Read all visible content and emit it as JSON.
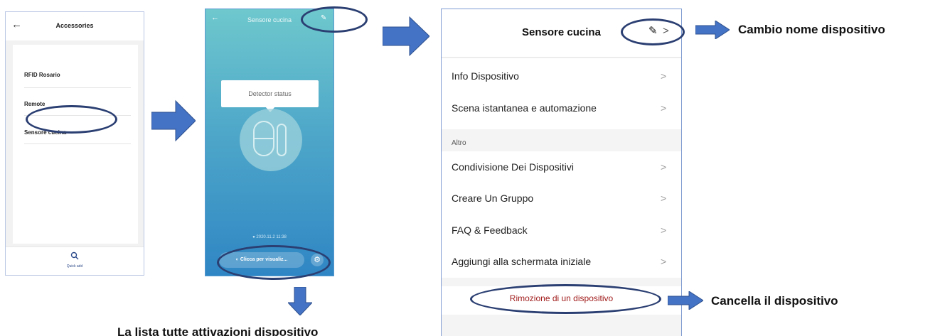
{
  "panel1": {
    "title": "Accessories",
    "items": [
      "RFID Rosario",
      "Remote",
      "Sensore cucina"
    ],
    "quick_add_label": "Quick add"
  },
  "panel2": {
    "title": "Sensore cucina",
    "tooltip": "Detector status",
    "timestamp": "2020.11.2 11:38",
    "view_button_label": "Clicca per visualiz..."
  },
  "panel3": {
    "title": "Sensore cucina",
    "group1": [
      "Info Dispositivo",
      "Scena istantanea e automazione"
    ],
    "section_label": "Altro",
    "group2": [
      "Condivisione Dei Dispositivi",
      "Creare Un Gruppo",
      "FAQ & Feedback",
      "Aggiungi alla schermata iniziale"
    ],
    "remove_label": "Rimozione di un dispositivo"
  },
  "annotations": {
    "rename": "Cambio nome dispositivo",
    "delete": "Cancella il dispositivo",
    "list": "La lista tutte attivazioni dispositivo"
  },
  "colors": {
    "arrow": "#4472c4",
    "ellipse": "#2b3f72",
    "remove_text": "#a11b1b"
  }
}
